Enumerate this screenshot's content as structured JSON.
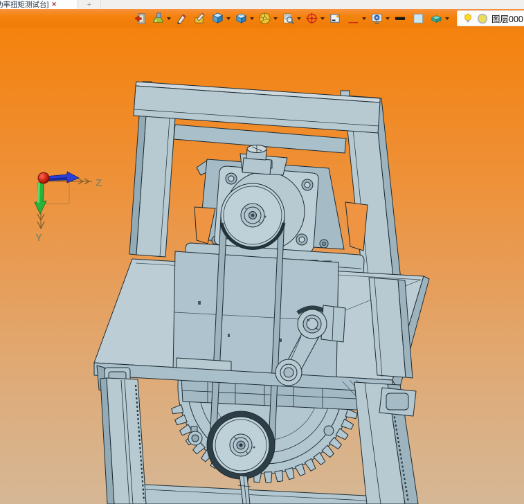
{
  "tab_bar": {
    "active_tab_label": "功率扭矩测试台]",
    "close_label": "✕",
    "new_tab_label": "+"
  },
  "toolbar": {
    "icons": [
      {
        "name": "exit-door",
        "dropdown": false
      },
      {
        "name": "material",
        "dropdown": true
      },
      {
        "name": "pencil",
        "dropdown": false
      },
      {
        "name": "sketch-box",
        "dropdown": false
      },
      {
        "name": "cube",
        "dropdown": true
      },
      {
        "name": "cube-half",
        "dropdown": true
      },
      {
        "name": "pie-wheel",
        "dropdown": true
      },
      {
        "name": "doc-zoom",
        "dropdown": true
      },
      {
        "name": "target",
        "dropdown": true
      },
      {
        "name": "frame-dot",
        "dropdown": false
      },
      {
        "name": "clamp",
        "dropdown": true
      },
      {
        "name": "monitor-gear",
        "dropdown": true
      },
      {
        "name": "line-width",
        "dropdown": false
      },
      {
        "name": "color-swatch",
        "dropdown": false
      },
      {
        "name": "wedge",
        "dropdown": true
      }
    ],
    "layer_panel": {
      "layer_label": "图层000"
    }
  },
  "viewport": {
    "triad": {
      "z_label": "Z",
      "y_label": "Y"
    },
    "colors": {
      "bg_top": "#f5820d",
      "bg_bottom": "#d6b795",
      "model_fill": "#b3c7d0",
      "model_edge": "#1d2c34",
      "axis_z": "#2b3fd6",
      "axis_y": "#27b43a",
      "axis_origin": "#cc2211",
      "axis_label": "#8f845e"
    }
  }
}
